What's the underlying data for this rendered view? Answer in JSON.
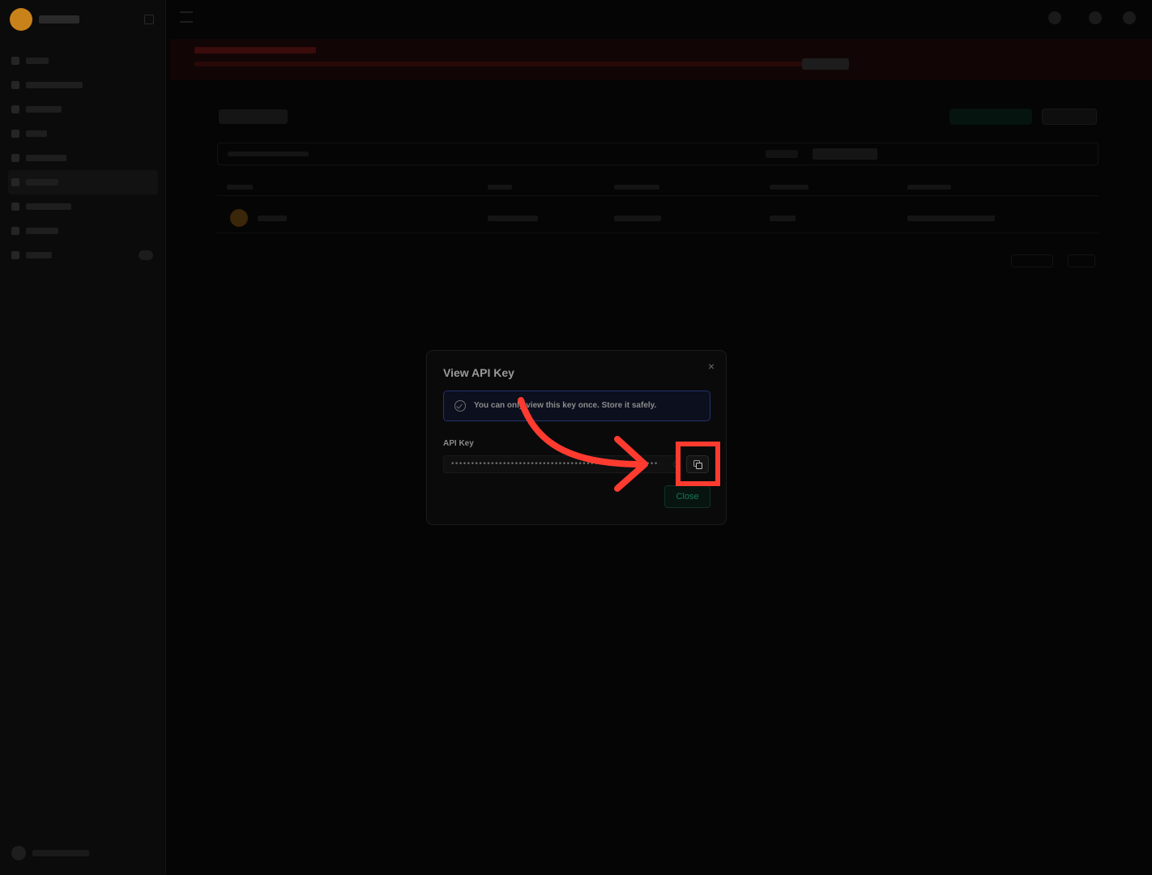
{
  "modal": {
    "title": "View API Key",
    "close_icon": "×",
    "notice": "You can only view this key once. Store it safely.",
    "field_label": "API Key",
    "key_value": "••••••••••••••••••••••••••••••••••••••••••••••••••••",
    "copy_icon": "copy-icon",
    "close_label": "Close"
  },
  "annotation": {
    "color": "#ff3b30",
    "target": "copy-button"
  },
  "colors": {
    "accent": "#157a55",
    "info_border": "#233370",
    "warning_banner": "#120505"
  }
}
